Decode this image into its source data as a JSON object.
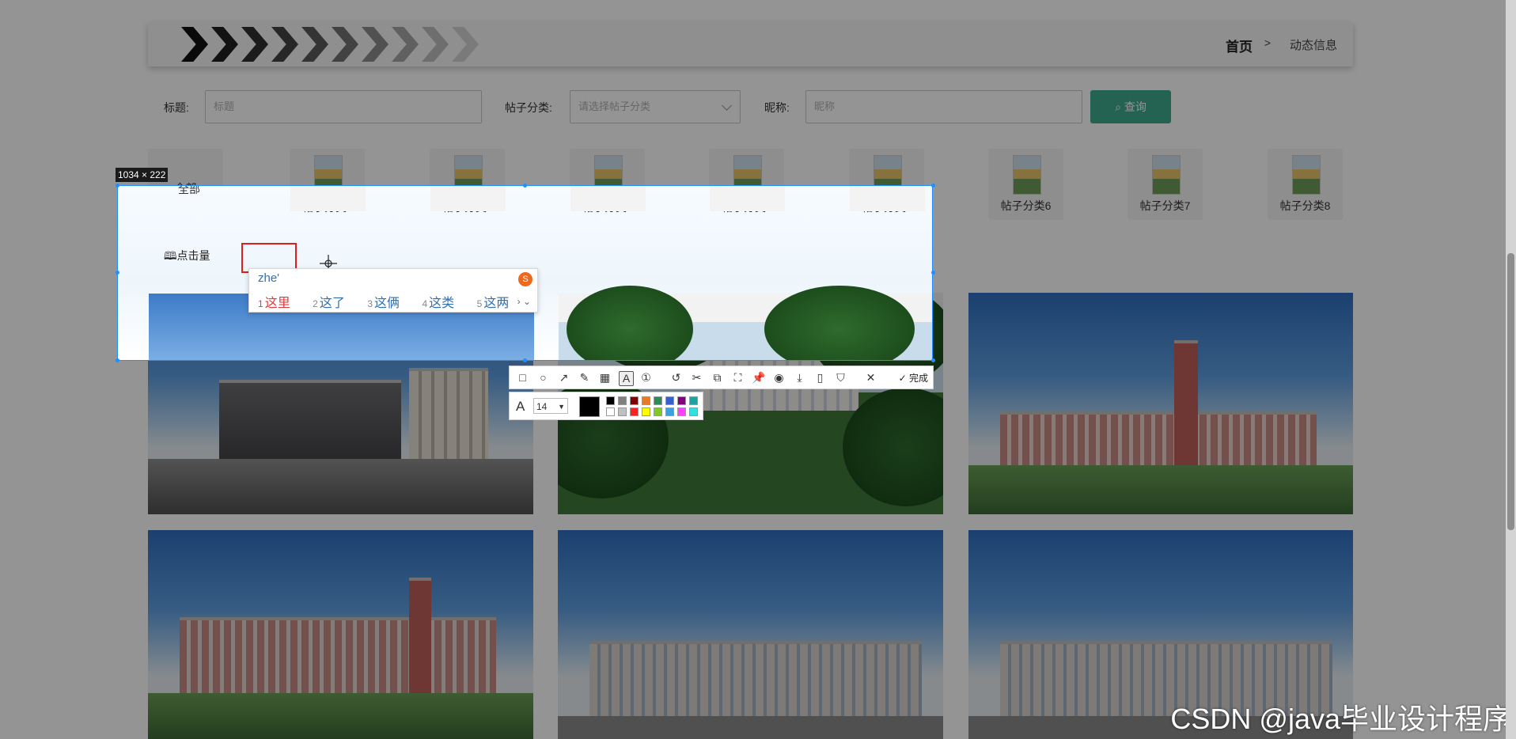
{
  "breadcrumb": {
    "home": "首页",
    "separator": ">",
    "current": "动态信息"
  },
  "search": {
    "title_label": "标题:",
    "title_placeholder": "标题",
    "category_label": "帖子分类:",
    "category_placeholder": "请选择帖子分类",
    "nickname_label": "昵称:",
    "nickname_placeholder": "昵称",
    "query_button": "查询",
    "query_icon": "search-icon"
  },
  "categories": [
    {
      "label": "全部"
    },
    {
      "label": "帖子分类1"
    },
    {
      "label": "帖子分类2"
    },
    {
      "label": "帖子分类3"
    },
    {
      "label": "帖子分类4"
    },
    {
      "label": "帖子分类5"
    },
    {
      "label": "帖子分类6"
    },
    {
      "label": "帖子分类7"
    },
    {
      "label": "帖子分类8"
    }
  ],
  "sort": {
    "label": "点击量",
    "icon": "book-icon"
  },
  "screenshot_tool": {
    "size_label": "1034 × 222",
    "done_label": "完成",
    "font_size": "14",
    "current_color": "#000000",
    "palette": [
      "#000000",
      "#808080",
      "#800000",
      "#e87b27",
      "#2e8b57",
      "#3a5fcd",
      "#800080",
      "#20a0a0",
      "#ffffff",
      "#c0c0c0",
      "#ff2020",
      "#ffff00",
      "#7fcc20",
      "#3aa0e0",
      "#ff40ff",
      "#30e0e0"
    ],
    "tools": [
      "rectangle-icon",
      "ellipse-icon",
      "arrow-icon",
      "pen-icon",
      "mosaic-icon",
      "text-icon",
      "number-icon",
      "undo-icon",
      "magic-icon",
      "ocr-icon",
      "scissors-icon",
      "pin-icon",
      "record-icon",
      "download-icon",
      "phone-icon",
      "bookmark-icon",
      "close-icon"
    ]
  },
  "ime": {
    "input": "zhe'",
    "candidates": [
      {
        "n": "1",
        "text": "这里"
      },
      {
        "n": "2",
        "text": "这了"
      },
      {
        "n": "3",
        "text": "这俩"
      },
      {
        "n": "4",
        "text": "这类"
      },
      {
        "n": "5",
        "text": "这两"
      }
    ],
    "nav": "› ⌄"
  },
  "watermark": "CSDN @java毕业设计程序"
}
